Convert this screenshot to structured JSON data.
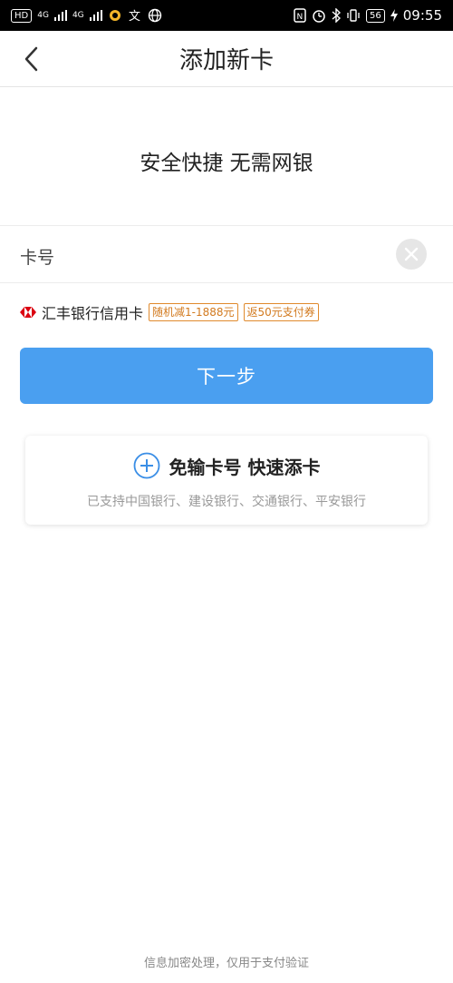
{
  "status_bar": {
    "hd": "HD",
    "net1": "4G",
    "net2": "4G",
    "battery": "56",
    "time": "09:55"
  },
  "header": {
    "title": "添加新卡"
  },
  "slogan": "安全快捷 无需网银",
  "card_input": {
    "label": "卡号",
    "value": ""
  },
  "promo": {
    "bank_name": "汇丰银行信用卡",
    "tags": [
      "随机减1-1888元",
      "返50元支付券"
    ],
    "brand_color": "#db0011"
  },
  "next_button": {
    "label": "下一步",
    "color": "#4a9ff0"
  },
  "quick_add": {
    "title": "免输卡号 快速添卡",
    "subtitle": "已支持中国银行、建设银行、交通银行、平安银行",
    "icon": "plus-circle-icon"
  },
  "footer": {
    "note": "信息加密处理，仅用于支付验证"
  }
}
